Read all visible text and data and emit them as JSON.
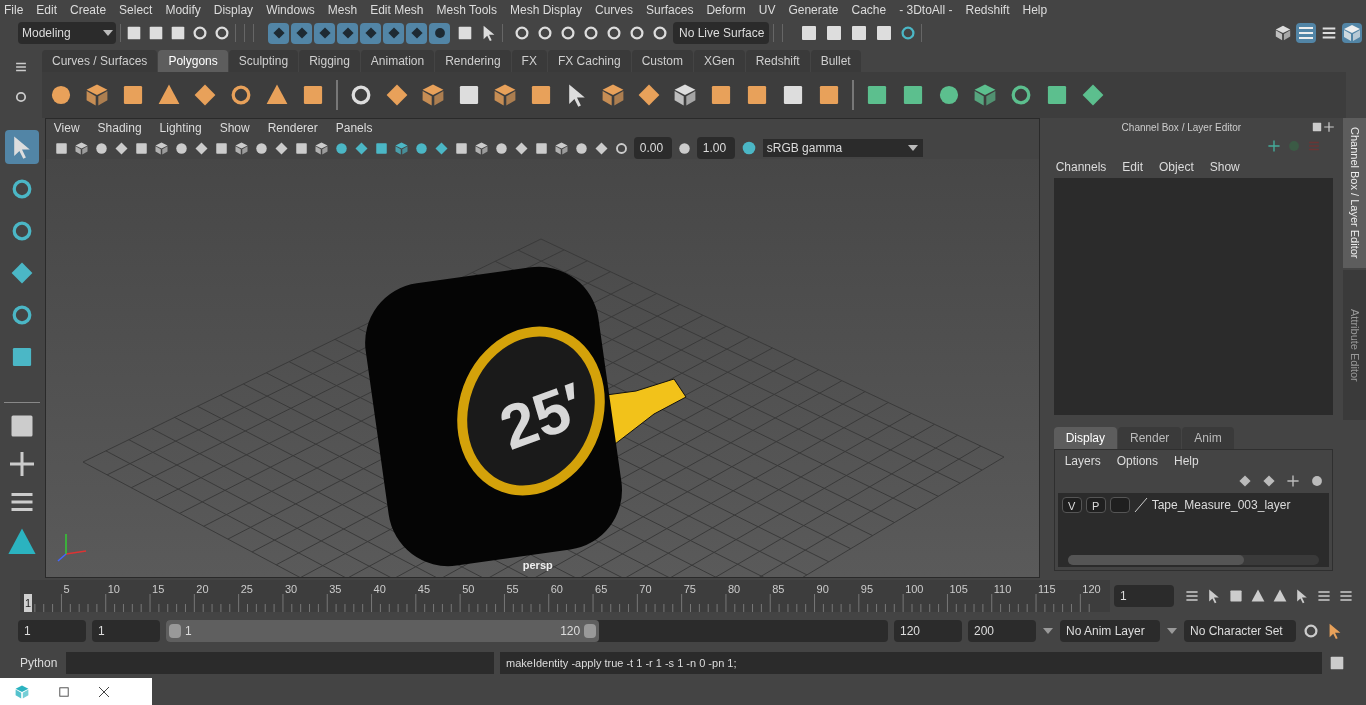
{
  "menu": [
    "File",
    "Edit",
    "Create",
    "Select",
    "Modify",
    "Display",
    "Windows",
    "Mesh",
    "Edit Mesh",
    "Mesh Tools",
    "Mesh Display",
    "Curves",
    "Surfaces",
    "Deform",
    "UV",
    "Generate",
    "Cache",
    "- 3DtoAll -",
    "Redshift",
    "Help"
  ],
  "status_line": {
    "workspace": "Modeling",
    "mask_buttons": [
      {
        "on": true
      },
      {
        "on": true
      },
      {
        "on": true
      },
      {
        "on": true
      },
      {
        "on": true
      },
      {
        "on": true
      },
      {
        "on": true
      },
      {
        "on": true
      }
    ],
    "live_surface": "No Live Surface"
  },
  "shelf_tabs": [
    {
      "label": "Curves / Surfaces",
      "selected": false
    },
    {
      "label": "Polygons",
      "selected": true
    },
    {
      "label": "Sculpting",
      "selected": false
    },
    {
      "label": "Rigging",
      "selected": false
    },
    {
      "label": "Animation",
      "selected": false
    },
    {
      "label": "Rendering",
      "selected": false
    },
    {
      "label": "FX",
      "selected": false
    },
    {
      "label": "FX Caching",
      "selected": false
    },
    {
      "label": "Custom",
      "selected": false
    },
    {
      "label": "XGen",
      "selected": false
    },
    {
      "label": "Redshift",
      "selected": false
    },
    {
      "label": "Bullet",
      "selected": false
    }
  ],
  "tools": [
    {
      "selected": true
    },
    {
      "selected": false
    },
    {
      "selected": false
    },
    {
      "selected": false
    },
    {
      "selected": false
    },
    {
      "selected": false
    }
  ],
  "viewport": {
    "menu": [
      "View",
      "Shading",
      "Lighting",
      "Show",
      "Renderer",
      "Panels"
    ],
    "exposure": "0.00",
    "gamma": "1.00",
    "color_space": "sRGB gamma",
    "model_label": "25′",
    "camera": "persp"
  },
  "channel_box": {
    "title": "Channel Box / Layer Editor",
    "menu": [
      "Channels",
      "Edit",
      "Object",
      "Show"
    ],
    "layer_tabs": [
      {
        "label": "Display",
        "selected": true
      },
      {
        "label": "Render",
        "selected": false
      },
      {
        "label": "Anim",
        "selected": false
      }
    ],
    "layer_menu": [
      "Layers",
      "Options",
      "Help"
    ],
    "layers": [
      {
        "visible": "V",
        "playback": "P",
        "name": "Tape_Measure_003_layer"
      }
    ]
  },
  "side_tabs": [
    {
      "label": "Channel Box / Layer Editor",
      "selected": true
    },
    {
      "label": "Attribute Editor",
      "selected": false
    }
  ],
  "timeline": {
    "start_label": "1",
    "ticks": [
      "5",
      "10",
      "15",
      "20",
      "25",
      "30",
      "35",
      "40",
      "45",
      "50",
      "55",
      "60",
      "65",
      "70",
      "75",
      "80",
      "85",
      "90",
      "95",
      "100",
      "105",
      "110",
      "115",
      "120"
    ],
    "current_frame": "1",
    "level": 0
  },
  "range": {
    "start": "1",
    "playback_start": "1",
    "slider_start": "1",
    "slider_end": "120",
    "level": 0.6,
    "playback_end": "120",
    "end": "200",
    "anim_layer": "No Anim Layer",
    "character_set": "No Character Set"
  },
  "command": {
    "language": "Python",
    "output": "makeIdentity -apply true -t 1 -r 1 -s 1 -n 0 -pn 1;"
  }
}
